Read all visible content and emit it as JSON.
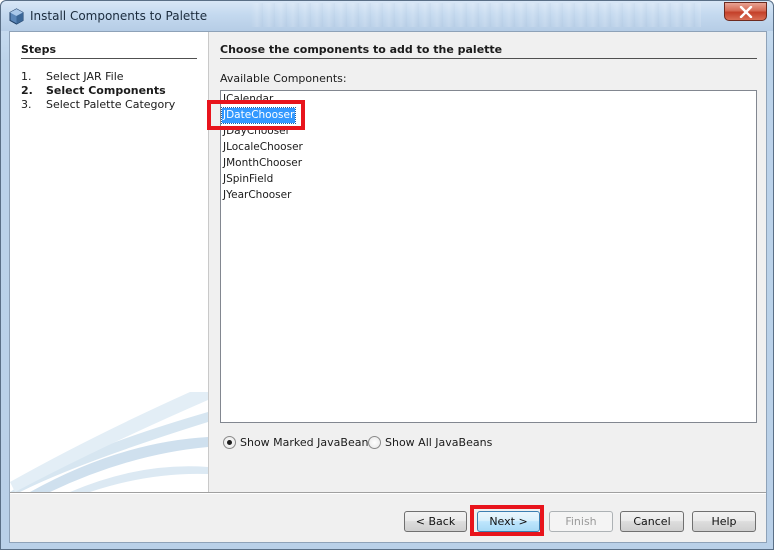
{
  "window": {
    "title": "Install Components to Palette"
  },
  "steps": {
    "heading": "Steps",
    "items": [
      {
        "num": "1.",
        "label": "Select JAR File"
      },
      {
        "num": "2.",
        "label": "Select Components"
      },
      {
        "num": "3.",
        "label": "Select Palette Category"
      }
    ],
    "current_index": 1
  },
  "main": {
    "heading": "Choose the components to add to the palette",
    "available_label": "Available Components:",
    "components": [
      "JCalendar",
      "JDateChooser",
      "JDayChooser",
      "JLocaleChooser",
      "JMonthChooser",
      "JSpinField",
      "JYearChooser"
    ],
    "selected_component": "JDateChooser",
    "radio_marked": "Show Marked JavaBeans",
    "radio_all": "Show All JavaBeans",
    "radio_selected": "marked"
  },
  "buttons": {
    "back": "< Back",
    "next": "Next >",
    "finish": "Finish",
    "cancel": "Cancel",
    "help": "Help"
  },
  "colors": {
    "highlight": "#e8141c",
    "selection": "#3399ff"
  }
}
